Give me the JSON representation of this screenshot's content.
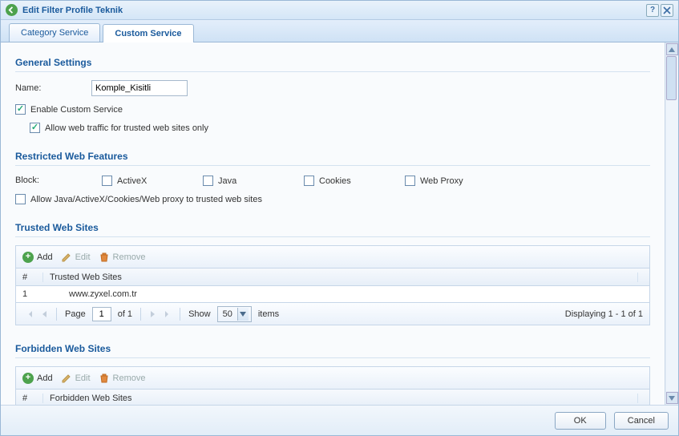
{
  "dialog": {
    "title": "Edit Filter Profile Teknik"
  },
  "tabs": {
    "category": "Category Service",
    "custom": "Custom Service"
  },
  "general": {
    "heading": "General Settings",
    "name_label": "Name:",
    "name_value": "Komple_Kisitli",
    "enable_label": "Enable Custom Service",
    "allow_trusted_only_label": "Allow web traffic for trusted web sites only"
  },
  "restricted": {
    "heading": "Restricted Web Features",
    "block_label": "Block:",
    "activex_label": "ActiveX",
    "java_label": "Java",
    "cookies_label": "Cookies",
    "webproxy_label": "Web Proxy",
    "allow_to_trusted_label": "Allow Java/ActiveX/Cookies/Web proxy to trusted web sites"
  },
  "trusted": {
    "heading": "Trusted Web Sites",
    "toolbar": {
      "add": "Add",
      "edit": "Edit",
      "remove": "Remove"
    },
    "col_idx": "#",
    "col_name": "Trusted Web Sites",
    "rows": [
      {
        "idx": "1",
        "site": "www.zyxel.com.tr"
      }
    ],
    "pager": {
      "page_label": "Page",
      "page_value": "1",
      "of_label": "of 1",
      "show_label": "Show",
      "pagesize": "50",
      "items_label": "items",
      "display": "Displaying 1 - 1 of 1"
    }
  },
  "forbidden": {
    "heading": "Forbidden Web Sites",
    "toolbar": {
      "add": "Add",
      "edit": "Edit",
      "remove": "Remove"
    },
    "col_idx": "#",
    "col_name": "Forbidden Web Sites"
  },
  "footer": {
    "ok": "OK",
    "cancel": "Cancel"
  }
}
